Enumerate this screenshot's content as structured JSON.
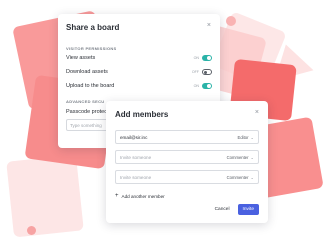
{
  "share_dialog": {
    "title": "Share a board",
    "close": "×",
    "visitor_section": "VISITOR PERMISSIONS",
    "permissions": [
      {
        "label": "View assets",
        "state": "ON",
        "on": true
      },
      {
        "label": "Download assets",
        "state": "OFF",
        "on": false
      },
      {
        "label": "Upload to the board",
        "state": "ON",
        "on": true
      }
    ],
    "advanced_section": "ADVANCED SECU",
    "passcode_label": "Passcode protec",
    "passcode_placeholder": "Type something"
  },
  "members_dialog": {
    "title": "Add members",
    "close": "×",
    "fields": [
      {
        "value": "email@sir.inc",
        "placeholder": "",
        "role": "Editor"
      },
      {
        "value": "",
        "placeholder": "Invite someone",
        "role": "Commenter"
      },
      {
        "value": "",
        "placeholder": "Invite someone",
        "role": "Commenter"
      }
    ],
    "add_another": "Add another member",
    "cancel_label": "Cancel",
    "invite_label": "Invite"
  },
  "colors": {
    "accent": "#4a61e0",
    "toggle_on": "#2bb3a8",
    "decor": "#f46b6b"
  }
}
